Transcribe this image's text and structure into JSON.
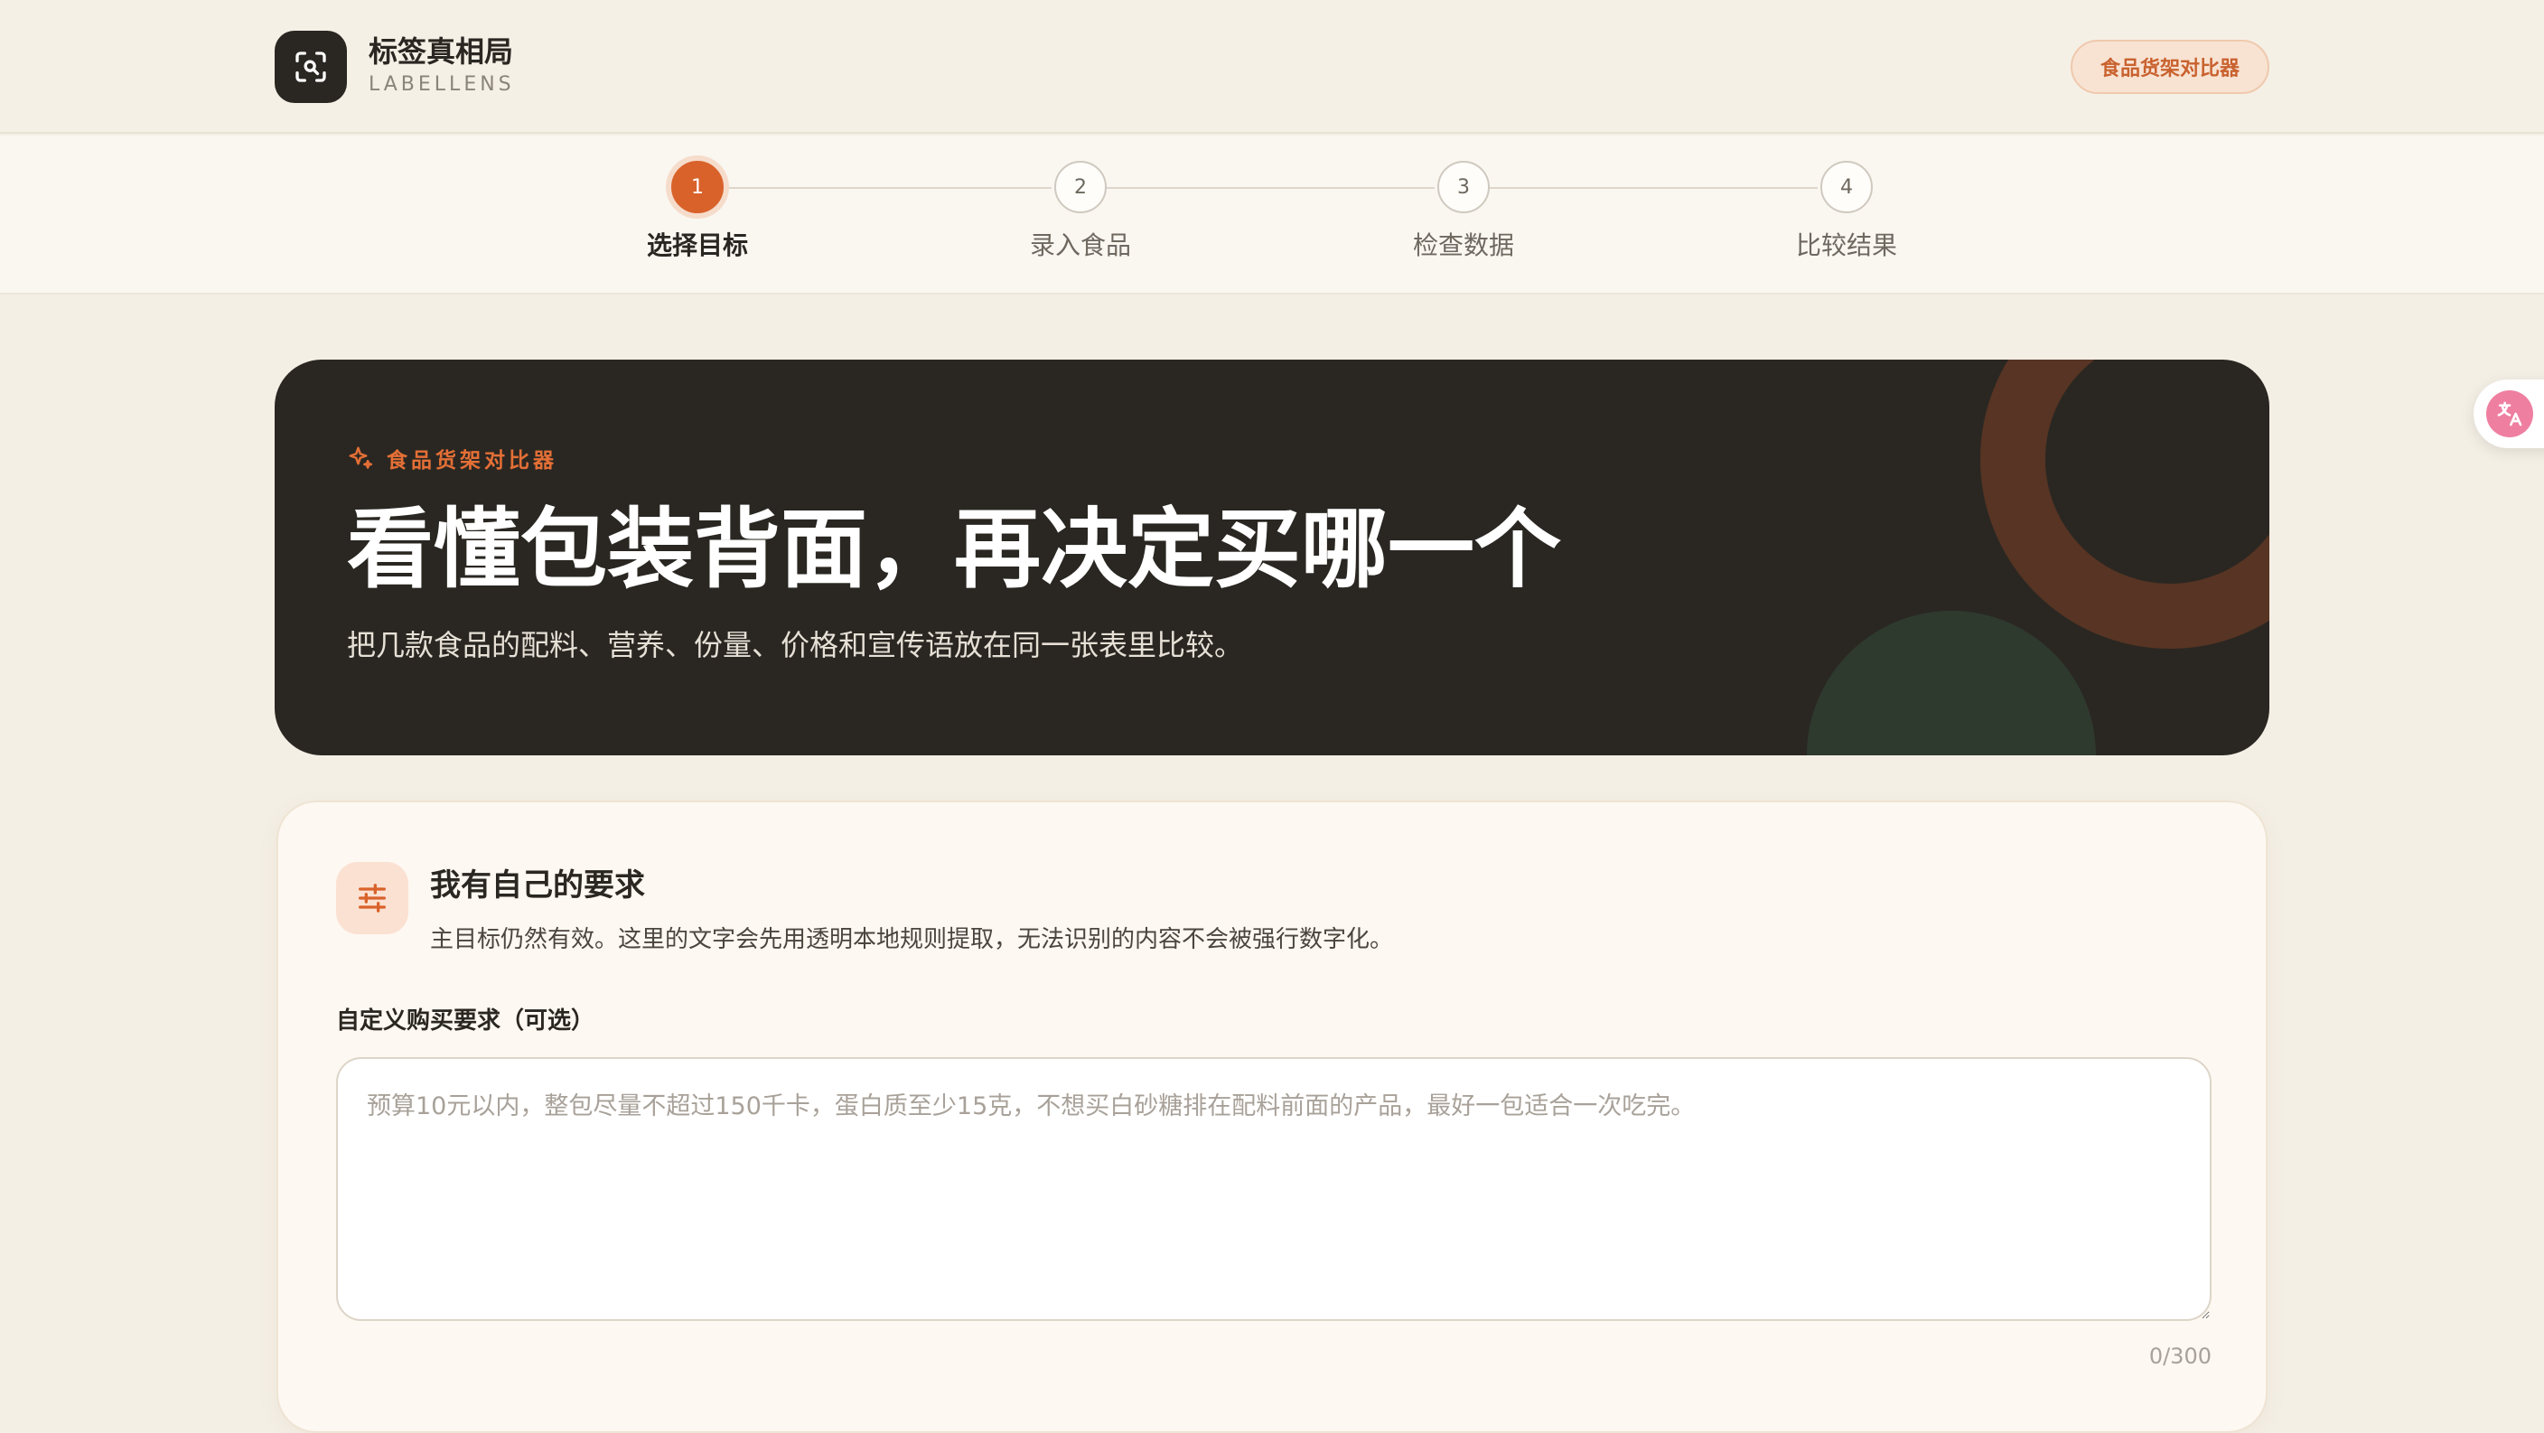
{
  "header": {
    "brand_name": "标签真相局",
    "brand_sub": "LABELLENS",
    "pill_label": "食品货架对比器"
  },
  "steps": [
    {
      "number": "1",
      "label": "选择目标",
      "active": true
    },
    {
      "number": "2",
      "label": "录入食品",
      "active": false
    },
    {
      "number": "3",
      "label": "检查数据",
      "active": false
    },
    {
      "number": "4",
      "label": "比较结果",
      "active": false
    }
  ],
  "hero": {
    "tag": "食品货架对比器",
    "title": "看懂包装背面，再决定买哪一个",
    "subtitle": "把几款食品的配料、营养、份量、价格和宣传语放在同一张表里比较。"
  },
  "custom": {
    "title": "我有自己的要求",
    "description": "主目标仍然有效。这里的文字会先用透明本地规则提取，无法识别的内容不会被强行数字化。",
    "field_label": "自定义购买要求（可选）",
    "placeholder": "预算10元以内，整包尽量不超过150千卡，蛋白质至少15克，不想买白砂糖排在配料前面的产品，最好一包适合一次吃完。",
    "value": "",
    "counter": "0/300"
  },
  "icons": {
    "logo": "scan-search-icon",
    "hero_tag": "sparkle-icon",
    "card": "sliders-icon",
    "translate": "translate-icon"
  },
  "colors": {
    "accent": "#d9622b",
    "dark": "#2a2722",
    "background": "#f4efe5"
  }
}
